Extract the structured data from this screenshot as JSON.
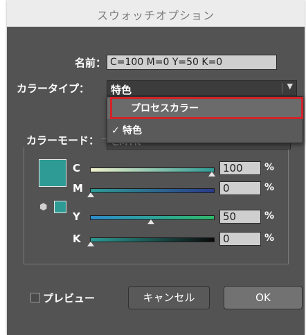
{
  "window": {
    "title": "スウォッチオプション"
  },
  "fields": {
    "name_label": "名前：",
    "name_value": "C=100 M=0 Y=50 K=0",
    "color_type_label": "カラータイプ：",
    "color_type_value": "特色",
    "color_mode_label": "カラーモード：",
    "color_mode_value": "CMYK"
  },
  "dropdown": {
    "items": [
      {
        "label": "プロセスカラー",
        "checked": false,
        "highlighted": true
      },
      {
        "label": "特色",
        "checked": true,
        "check_mark": "✓"
      }
    ]
  },
  "channels": [
    {
      "label": "C",
      "value": "100",
      "unit": "%",
      "level": 100
    },
    {
      "label": "M",
      "value": "0",
      "unit": "%",
      "level": 0
    },
    {
      "label": "Y",
      "value": "50",
      "unit": "%",
      "level": 50
    },
    {
      "label": "K",
      "value": "0",
      "unit": "%",
      "level": 0
    }
  ],
  "preview": {
    "label": "プレビュー",
    "checked": false
  },
  "buttons": {
    "cancel": "キャンセル",
    "ok": "OK"
  },
  "colors": {
    "swatch": "#2e9b94",
    "highlight_border": "#d2232a",
    "dialog_bg": "#535353"
  },
  "icons": {
    "color_cube": "cube-icon",
    "dropdown_arrow": "triangle-down"
  }
}
